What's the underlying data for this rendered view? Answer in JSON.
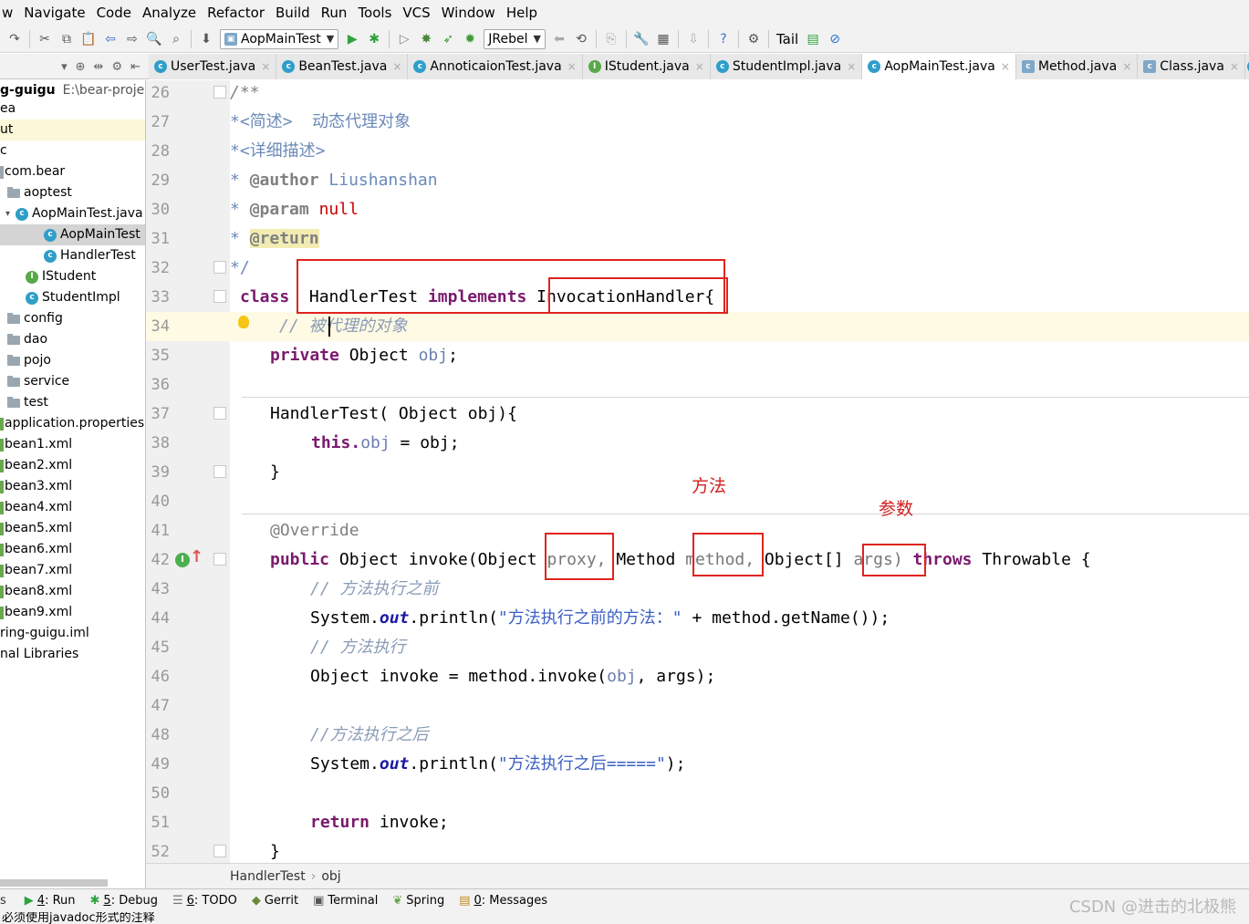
{
  "menu": [
    "w",
    "Navigate",
    "Code",
    "Analyze",
    "Refactor",
    "Build",
    "Run",
    "Tools",
    "VCS",
    "Window",
    "Help"
  ],
  "toolbar": {
    "run_config": "AopMainTest",
    "jrebel": "JRebel",
    "tail": "Tail"
  },
  "tabs": [
    {
      "label": "UserTest.java",
      "active": false
    },
    {
      "label": "BeanTest.java",
      "active": false
    },
    {
      "label": "AnnoticaionTest.java",
      "active": false
    },
    {
      "label": "IStudent.java",
      "active": false,
      "icon": "interface"
    },
    {
      "label": "StudentImpl.java",
      "active": false
    },
    {
      "label": "AopMainTest.java",
      "active": true
    },
    {
      "label": "Method.java",
      "active": false,
      "icon": "library"
    },
    {
      "label": "Class.java",
      "active": false,
      "icon": "library"
    }
  ],
  "project": {
    "root_name": "g-guigu",
    "root_path": "E:\\bear-projec",
    "items": [
      "ea",
      "ut",
      "c",
      "com.bear",
      "aoptest",
      "AopMainTest.java",
      "AopMainTest",
      "HandlerTest",
      "IStudent",
      "StudentImpl",
      "config",
      "dao",
      "pojo",
      "service",
      "test",
      "application.properties",
      "bean1.xml",
      "bean2.xml",
      "bean3.xml",
      "bean4.xml",
      "bean5.xml",
      "bean6.xml",
      "bean7.xml",
      "bean8.xml",
      "bean9.xml",
      "ring-guigu.iml",
      "nal Libraries"
    ]
  },
  "editor": {
    "line_numbers": [
      "26",
      "27",
      "28",
      "29",
      "30",
      "31",
      "32",
      "33",
      "34",
      "35",
      "36",
      "37",
      "38",
      "39",
      "40",
      "41",
      "42",
      "43",
      "44",
      "45",
      "46",
      "47",
      "48",
      "49",
      "50",
      "51",
      "52"
    ],
    "current_line": "34",
    "doc": {
      "open": "/**",
      "brief": "*<简述>  动态代理对象",
      "detail": "*<详细描述>",
      "author_tag": "@author",
      "author": "Liushanshan",
      "param_tag": "@param",
      "param": "null",
      "return_tag": "@return",
      "close": "*/"
    },
    "code": {
      "class_kw": "class",
      "class_name": "HandlerTest",
      "implements_kw": "implements",
      "interface": "InvocationHandler",
      "brace_open": "{",
      "comment_target": "// 被代理的对象",
      "private_kw": "private",
      "obj_type": "Object",
      "obj_field": "obj",
      "ctor_name": "HandlerTest(",
      "ctor_param": "Object obj){",
      "this_kw": "this.",
      "assign": " = obj;",
      "brace_close": "}",
      "override": "@Override",
      "public_kw": "public",
      "invoke_sig": "Object invoke(Object",
      "proxy": "proxy,",
      "method_type": "Method",
      "method": "method,",
      "objarr": "Object[]",
      "args": "args)",
      "throws_kw": "throws",
      "throwable": "Throwable {",
      "comment_before": "// 方法执行之前",
      "sys": "System.",
      "out": "out",
      "println_before": ".println(",
      "str_before": "\"方法执行之前的方法：\"",
      "concat": " + method.getName());",
      "comment_exec": "// 方法执行",
      "invoke_line": "Object invoke = method.invoke(",
      "invoke_obj": "obj",
      "invoke_args": ", args);",
      "comment_after": "//方法执行之后",
      "println_after": ".println(",
      "str_after": "\"方法执行之后=====\"",
      "println_end": ");",
      "return_kw": "return",
      "return_val": " invoke;"
    },
    "annotations": {
      "method_label": "方法",
      "param_label": "参数"
    }
  },
  "breadcrumb": [
    "HandlerTest",
    "obj"
  ],
  "bottom_tools": [
    {
      "key": "4",
      "label": ": Run"
    },
    {
      "key": "5",
      "label": ": Debug"
    },
    {
      "key": "6",
      "label": ": TODO"
    },
    {
      "key": "",
      "label": "Gerrit"
    },
    {
      "key": "",
      "label": "Terminal"
    },
    {
      "key": "",
      "label": "Spring"
    },
    {
      "key": "0",
      "label": ": Messages"
    }
  ],
  "status_message": "必须使用javadoc形式的注释",
  "watermark": "CSDN @进击的北极熊"
}
